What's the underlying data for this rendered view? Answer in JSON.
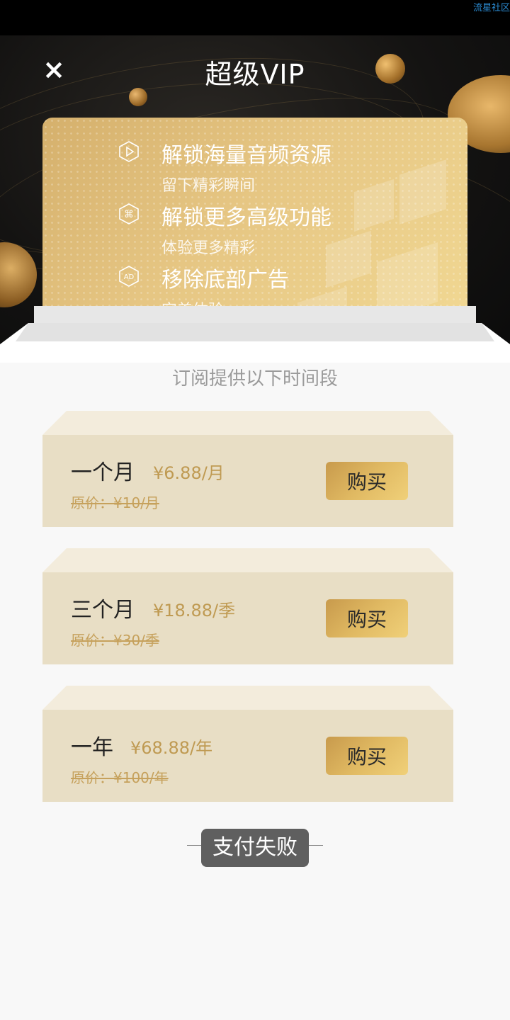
{
  "status_bar": {
    "watermark": "流星社区"
  },
  "header": {
    "title": "超级VIP",
    "close_icon": "×"
  },
  "benefits": [
    {
      "icon": "play-icon",
      "title": "解锁海量音频资源",
      "subtitle": "留下精彩瞬间"
    },
    {
      "icon": "command-icon",
      "title": "解锁更多高级功能",
      "subtitle": "体验更多精彩"
    },
    {
      "icon": "ad-icon",
      "icon_text": "AD",
      "title": "移除底部广告",
      "subtitle": "完美体验"
    }
  ],
  "subscription": {
    "heading": "订阅提供以下时间段",
    "plans": [
      {
        "name": "一个月",
        "price": "¥6.88/月",
        "original": "原价：¥10/月",
        "button": "购买"
      },
      {
        "name": "三个月",
        "price": "¥18.88/季",
        "original": "原价：¥30/季",
        "button": "购买"
      },
      {
        "name": "一年",
        "price": "¥68.88/年",
        "original": "原价：¥100/年",
        "button": "购买"
      }
    ]
  },
  "toast": {
    "message": "支付失败"
  },
  "colors": {
    "gold_accent": "#bf9a52",
    "plan_background": "#e8dec5",
    "button_gradient_start": "#c89a4c",
    "button_gradient_end": "#f0d079",
    "toast_background": "#5f5f5f"
  }
}
